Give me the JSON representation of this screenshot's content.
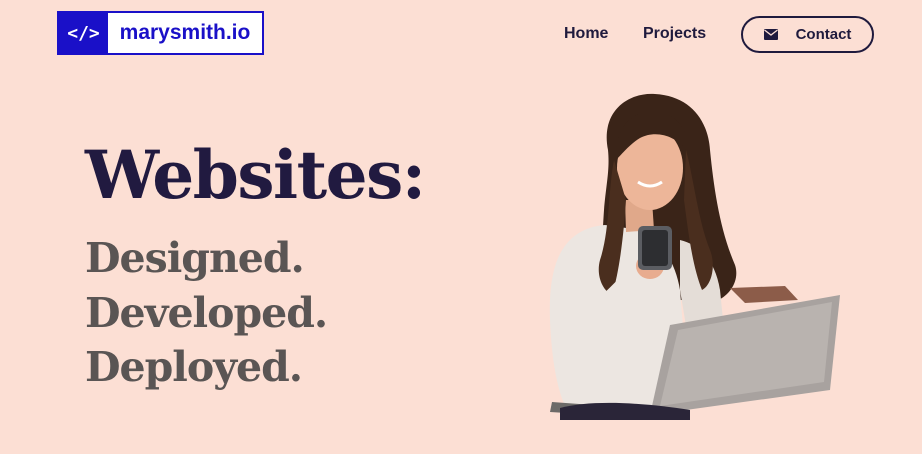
{
  "logo": {
    "mark": "</>",
    "text": "marysmith.io"
  },
  "nav": {
    "home": "Home",
    "projects": "Projects",
    "contact": "Contact"
  },
  "hero": {
    "title": "Websites:",
    "lines": [
      "Designed.",
      "Developed.",
      "Deployed."
    ]
  },
  "colors": {
    "background": "#fcdfd4",
    "brand": "#1a10c8",
    "heading": "#211a40",
    "subheading": "#5a5554"
  },
  "icons": {
    "contact": "envelope-icon"
  }
}
